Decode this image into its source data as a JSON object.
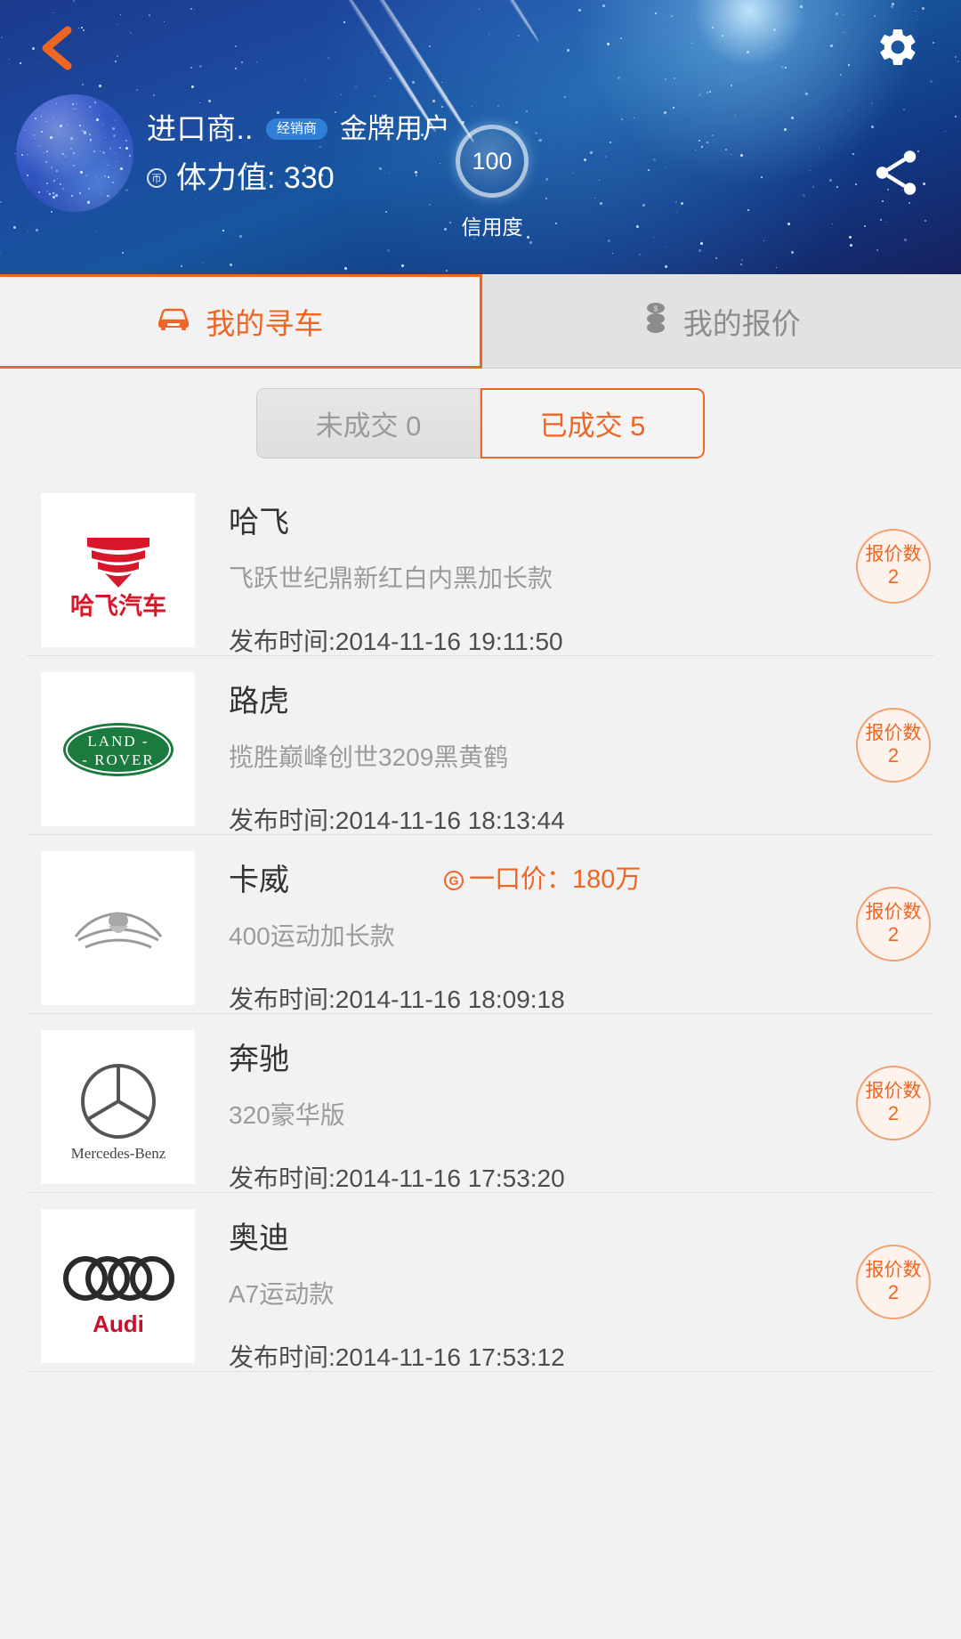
{
  "header": {
    "back_icon": "chevron-left-icon",
    "gear_icon": "gear-icon",
    "share_icon": "share-icon",
    "user_name": "进口商..",
    "dealer_tag": "经销商",
    "gold_user": "金牌用户",
    "energy_icon": "energy-icon",
    "energy_text": "体力值: 330",
    "credit_value": "100",
    "credit_label": "信用度"
  },
  "tabs": [
    {
      "label": "我的寻车",
      "icon": "car-icon",
      "active": true
    },
    {
      "label": "我的报价",
      "icon": "coins-icon",
      "active": false
    }
  ],
  "segment": [
    {
      "label": "未成交 0",
      "active": false
    },
    {
      "label": "已成交 5",
      "active": true
    }
  ],
  "list": {
    "time_prefix": "发布时间:",
    "rows": [
      {
        "brand": "哈飞",
        "logo": "haima-haifei-logo",
        "desc": "飞跃世纪鼎新红白内黑加长款",
        "time": "发布时间:2014-11-16 19:11:50",
        "price": "",
        "quote_label": "报价数",
        "quote_count": "2"
      },
      {
        "brand": "路虎",
        "logo": "land-rover-logo",
        "desc": "揽胜巅峰创世3209黑黄鹤",
        "time": "发布时间:2014-11-16 18:13:44",
        "price": "",
        "quote_label": "报价数",
        "quote_count": "2"
      },
      {
        "brand": "卡威",
        "logo": "kawei-logo",
        "desc": "400运动加长款",
        "time": "发布时间:2014-11-16 18:09:18",
        "price": "一口价：180万",
        "quote_label": "报价数",
        "quote_count": "2"
      },
      {
        "brand": "奔驰",
        "logo": "mercedes-benz-logo",
        "desc": "320豪华版",
        "time": "发布时间:2014-11-16 17:53:20",
        "price": "",
        "quote_label": "报价数",
        "quote_count": "2"
      },
      {
        "brand": "奥迪",
        "logo": "audi-logo",
        "desc": "A7运动款",
        "time": "发布时间:2014-11-16 17:53:12",
        "price": "",
        "quote_label": "报价数",
        "quote_count": "2"
      }
    ]
  },
  "colors": {
    "accent": "#ef6524",
    "header_blue": "#1c4aa0",
    "tag_blue": "#2f7fd6",
    "muted": "#9b9b9b"
  }
}
